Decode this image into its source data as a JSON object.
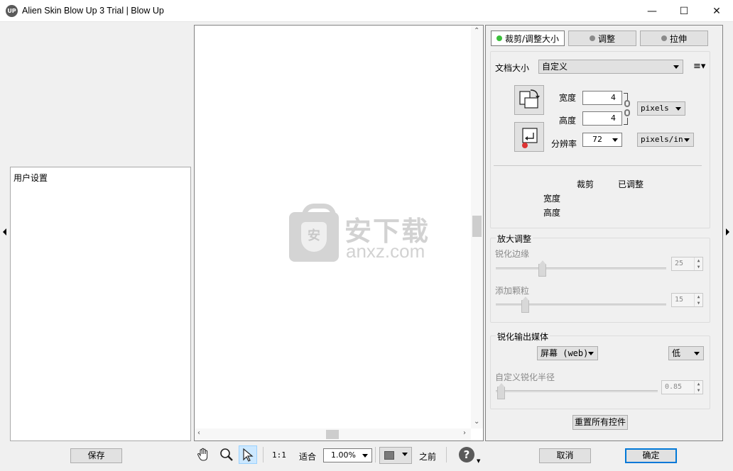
{
  "window": {
    "title": "Alien Skin Blow Up 3 Trial | Blow Up",
    "icon_text": "UP",
    "minimize": "—",
    "maximize": "☐",
    "close": "✕"
  },
  "left": {
    "user_settings_label": "用户设置",
    "save_button": "保存"
  },
  "watermark": {
    "cn": "安下载",
    "en": "anxz.com",
    "shield": "安"
  },
  "tabs": [
    {
      "label": "裁剪/调整大小",
      "active": true
    },
    {
      "label": "调整",
      "active": false
    },
    {
      "label": "拉伸",
      "active": false
    }
  ],
  "document": {
    "size_label": "文档大小",
    "size_value": "自定义",
    "width_label": "宽度",
    "width_value": "4",
    "height_label": "高度",
    "height_value": "4",
    "unit_value": "pixels",
    "resolution_label": "分辨率",
    "resolution_value": "72",
    "resolution_unit": "pixels/in",
    "col_crop": "裁剪",
    "col_adjusted": "已调整",
    "row_width": "宽度",
    "row_height": "高度"
  },
  "enlarge": {
    "title": "放大调整",
    "sharpen_edges_label": "锐化边缘",
    "sharpen_edges_value": "25",
    "sharpen_edges_level": 0.25,
    "add_grain_label": "添加颗粒",
    "add_grain_value": "15",
    "add_grain_level": 0.15
  },
  "output": {
    "title": "锐化输出媒体",
    "media_value": "屏幕 (web)",
    "strength_value": "低",
    "custom_radius_label": "自定义锐化半径",
    "custom_radius_value": "0.85",
    "custom_radius_level": 0.0
  },
  "reset_button": "重置所有控件",
  "toolbar": {
    "one_to_one": "1:1",
    "fit": "适合",
    "zoom_value": "1.00%",
    "before": "之前",
    "help": "?"
  },
  "dialog": {
    "cancel": "取消",
    "ok": "确定"
  },
  "icons": [
    "hand-icon",
    "magnifier-icon",
    "pointer-icon",
    "help-icon",
    "rotate-icon",
    "crop-reset-icon",
    "chain-link-icon",
    "menu-icon"
  ],
  "colors": {
    "active_tab_dot": "#3cbf3c",
    "ok_border": "#0078d7",
    "tool_selected": "#cce8ff"
  }
}
